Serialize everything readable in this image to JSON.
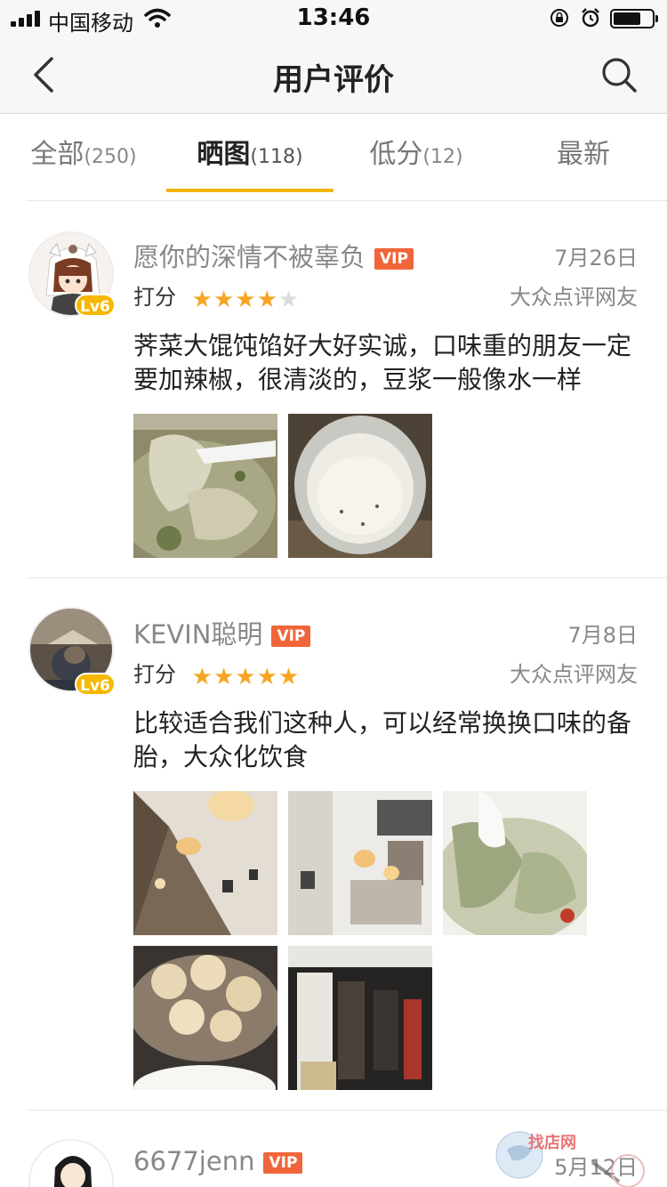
{
  "status_bar": {
    "carrier": "中国移动",
    "time": "13:46",
    "battery_level": 0.7
  },
  "nav": {
    "title": "用户评价",
    "back_icon": "chevron-left-icon",
    "search_icon": "search-icon"
  },
  "tabs": [
    {
      "label": "全部",
      "count": "(250)",
      "active": false
    },
    {
      "label": "晒图",
      "count": "(118)",
      "active": true
    },
    {
      "label": "低分",
      "count": "(12)",
      "active": false
    },
    {
      "label": "最新",
      "count": "",
      "active": false
    }
  ],
  "colors": {
    "accent": "#f4b400",
    "vip": "#f0663a",
    "star_on": "#f6a623",
    "star_off": "#dddddd"
  },
  "reviews": [
    {
      "name": "愿你的深情不被辜负",
      "vip": "VIP",
      "level": "Lv6",
      "date": "7月26日",
      "score_label": "打分",
      "rating": 4,
      "max_rating": 5,
      "user_type": "大众点评网友",
      "text": "荠菜大馄饨馅好大好实诚，口味重的朋友一定要加辣椒，很清淡的，豆浆一般像水一样",
      "photos": [
        "wonton-soup-photo",
        "soy-milk-cup-photo"
      ]
    },
    {
      "name": "KEVIN聪明",
      "vip": "VIP",
      "level": "Lv6",
      "date": "7月8日",
      "score_label": "打分",
      "rating": 5,
      "max_rating": 5,
      "user_type": "大众点评网友",
      "text": "比较适合我们这种人，可以经常换换口味的备胎，大众化饮食",
      "photos": [
        "restaurant-interior-photo",
        "restaurant-wall-photo",
        "wonton-spoon-photo",
        "steamed-shumai-photo",
        "restaurant-entrance-photo"
      ]
    },
    {
      "name": "6677jenn",
      "vip": "VIP",
      "date": "5月12日"
    }
  ],
  "watermark": {
    "text": "找店网"
  }
}
